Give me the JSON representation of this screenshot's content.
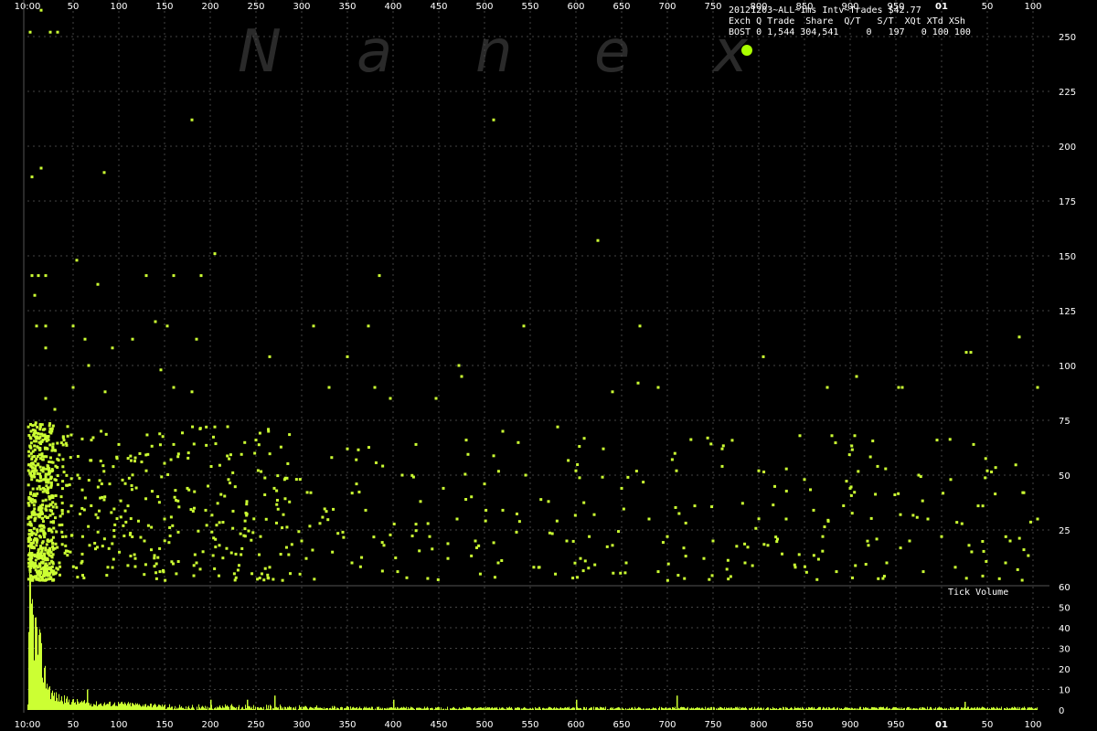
{
  "watermark": [
    "N",
    "a",
    "n",
    "e",
    "x"
  ],
  "legend": {
    "title": "20121203~ALL~1ms Intv~Trades $42.77",
    "header": "Exch Q Trade  Share  Q/T   S/T  XQt XTd XSh",
    "row": "BOST 0 1,544 304,541     0   197   0 100 100",
    "color": "#aaff00"
  },
  "volume_label": "Tick Volume",
  "chart_data": [
    {
      "type": "scatter",
      "title": "20121203~ALL~1ms Intv~Trades $42.77",
      "series": [
        {
          "name": "BOST",
          "color": "#ccff33"
        }
      ],
      "xticks": [
        "10:00",
        "50",
        "100",
        "150",
        "200",
        "250",
        "300",
        "350",
        "400",
        "450",
        "500",
        "550",
        "600",
        "650",
        "700",
        "750",
        "800",
        "850",
        "900",
        "950",
        "01",
        "50",
        "100"
      ],
      "bold_xticks": [
        "01"
      ],
      "yticks": [
        25,
        50,
        75,
        100,
        125,
        150,
        175,
        200,
        225,
        250
      ],
      "ylim": [
        0,
        265
      ],
      "grid": true,
      "points": [
        {
          "x": 3,
          "y": 252
        },
        {
          "x": 15,
          "y": 262
        },
        {
          "x": 25,
          "y": 252
        },
        {
          "x": 33,
          "y": 252
        },
        {
          "x": 15,
          "y": 190
        },
        {
          "x": 5,
          "y": 186
        },
        {
          "x": 180,
          "y": 212
        },
        {
          "x": 510,
          "y": 212
        },
        {
          "x": 84,
          "y": 188
        },
        {
          "x": 5,
          "y": 141
        },
        {
          "x": 12,
          "y": 141
        },
        {
          "x": 20,
          "y": 141
        },
        {
          "x": 130,
          "y": 141
        },
        {
          "x": 160,
          "y": 141
        },
        {
          "x": 190,
          "y": 141
        },
        {
          "x": 385,
          "y": 141
        },
        {
          "x": 54,
          "y": 148
        },
        {
          "x": 205,
          "y": 151
        },
        {
          "x": 77,
          "y": 137
        },
        {
          "x": 8,
          "y": 132
        },
        {
          "x": 624,
          "y": 157
        },
        {
          "x": 10,
          "y": 118
        },
        {
          "x": 20,
          "y": 118
        },
        {
          "x": 50,
          "y": 118
        },
        {
          "x": 140,
          "y": 120
        },
        {
          "x": 153,
          "y": 118
        },
        {
          "x": 313,
          "y": 118
        },
        {
          "x": 373,
          "y": 118
        },
        {
          "x": 543,
          "y": 118
        },
        {
          "x": 670,
          "y": 118
        },
        {
          "x": 115,
          "y": 112
        },
        {
          "x": 185,
          "y": 112
        },
        {
          "x": 20,
          "y": 108
        },
        {
          "x": 63,
          "y": 112
        },
        {
          "x": 93,
          "y": 108
        },
        {
          "x": 265,
          "y": 104
        },
        {
          "x": 350,
          "y": 104
        },
        {
          "x": 472,
          "y": 100
        },
        {
          "x": 805,
          "y": 104
        },
        {
          "x": 1027,
          "y": 106
        },
        {
          "x": 1085,
          "y": 113
        },
        {
          "x": 1032,
          "y": 106
        },
        {
          "x": 146,
          "y": 98
        },
        {
          "x": 475,
          "y": 95
        },
        {
          "x": 907,
          "y": 95
        },
        {
          "x": 67,
          "y": 100
        },
        {
          "x": 50,
          "y": 90
        },
        {
          "x": 85,
          "y": 88
        },
        {
          "x": 160,
          "y": 90
        },
        {
          "x": 180,
          "y": 88
        },
        {
          "x": 330,
          "y": 90
        },
        {
          "x": 380,
          "y": 90
        },
        {
          "x": 640,
          "y": 88
        },
        {
          "x": 668,
          "y": 92
        },
        {
          "x": 690,
          "y": 90
        },
        {
          "x": 875,
          "y": 90
        },
        {
          "x": 953,
          "y": 90
        },
        {
          "x": 957,
          "y": 90
        },
        {
          "x": 1105,
          "y": 90
        },
        {
          "x": 397,
          "y": 85
        },
        {
          "x": 447,
          "y": 85
        },
        {
          "x": 20,
          "y": 85
        },
        {
          "x": 30,
          "y": 80
        },
        {
          "x": 4,
          "y": 70
        },
        {
          "x": 18,
          "y": 68
        },
        {
          "x": 40,
          "y": 66
        },
        {
          "x": 70,
          "y": 66
        },
        {
          "x": 100,
          "y": 64
        },
        {
          "x": 160,
          "y": 64
        },
        {
          "x": 205,
          "y": 72
        },
        {
          "x": 250,
          "y": 66
        },
        {
          "x": 350,
          "y": 62
        },
        {
          "x": 425,
          "y": 64
        },
        {
          "x": 480,
          "y": 66
        },
        {
          "x": 520,
          "y": 70
        },
        {
          "x": 580,
          "y": 72
        },
        {
          "x": 630,
          "y": 62
        },
        {
          "x": 760,
          "y": 62
        },
        {
          "x": 845,
          "y": 68
        },
        {
          "x": 880,
          "y": 68
        },
        {
          "x": 905,
          "y": 68
        },
        {
          "x": 995,
          "y": 66
        },
        {
          "x": 1035,
          "y": 64
        },
        {
          "x": 10,
          "y": 52
        },
        {
          "x": 30,
          "y": 48
        },
        {
          "x": 55,
          "y": 50
        },
        {
          "x": 90,
          "y": 46
        },
        {
          "x": 130,
          "y": 52
        },
        {
          "x": 175,
          "y": 44
        },
        {
          "x": 220,
          "y": 48
        },
        {
          "x": 270,
          "y": 44
        },
        {
          "x": 310,
          "y": 42
        },
        {
          "x": 360,
          "y": 46
        },
        {
          "x": 410,
          "y": 50
        },
        {
          "x": 455,
          "y": 44
        },
        {
          "x": 500,
          "y": 46
        },
        {
          "x": 545,
          "y": 50
        },
        {
          "x": 600,
          "y": 52
        },
        {
          "x": 650,
          "y": 44
        },
        {
          "x": 710,
          "y": 52
        },
        {
          "x": 760,
          "y": 54
        },
        {
          "x": 800,
          "y": 52
        },
        {
          "x": 850,
          "y": 48
        },
        {
          "x": 900,
          "y": 44
        },
        {
          "x": 930,
          "y": 54
        },
        {
          "x": 975,
          "y": 50
        },
        {
          "x": 1010,
          "y": 48
        },
        {
          "x": 1050,
          "y": 52
        },
        {
          "x": 1090,
          "y": 42
        },
        {
          "x": 8,
          "y": 38
        },
        {
          "x": 25,
          "y": 34
        },
        {
          "x": 48,
          "y": 36
        },
        {
          "x": 75,
          "y": 32
        },
        {
          "x": 110,
          "y": 36
        },
        {
          "x": 150,
          "y": 30
        },
        {
          "x": 195,
          "y": 34
        },
        {
          "x": 240,
          "y": 38
        },
        {
          "x": 280,
          "y": 32
        },
        {
          "x": 320,
          "y": 28
        },
        {
          "x": 370,
          "y": 34
        },
        {
          "x": 430,
          "y": 38
        },
        {
          "x": 470,
          "y": 30
        },
        {
          "x": 520,
          "y": 34
        },
        {
          "x": 570,
          "y": 38
        },
        {
          "x": 620,
          "y": 32
        },
        {
          "x": 680,
          "y": 30
        },
        {
          "x": 730,
          "y": 36
        },
        {
          "x": 830,
          "y": 30
        },
        {
          "x": 860,
          "y": 34
        },
        {
          "x": 955,
          "y": 32
        },
        {
          "x": 985,
          "y": 30
        },
        {
          "x": 1040,
          "y": 36
        },
        {
          "x": 1105,
          "y": 30
        },
        {
          "x": 5,
          "y": 24
        },
        {
          "x": 22,
          "y": 20
        },
        {
          "x": 42,
          "y": 22
        },
        {
          "x": 68,
          "y": 18
        },
        {
          "x": 95,
          "y": 22
        },
        {
          "x": 128,
          "y": 20
        },
        {
          "x": 165,
          "y": 24
        },
        {
          "x": 210,
          "y": 18
        },
        {
          "x": 255,
          "y": 22
        },
        {
          "x": 300,
          "y": 20
        },
        {
          "x": 345,
          "y": 24
        },
        {
          "x": 390,
          "y": 18
        },
        {
          "x": 440,
          "y": 22
        },
        {
          "x": 490,
          "y": 20
        },
        {
          "x": 535,
          "y": 24
        },
        {
          "x": 590,
          "y": 20
        },
        {
          "x": 640,
          "y": 18
        },
        {
          "x": 700,
          "y": 22
        },
        {
          "x": 750,
          "y": 20
        },
        {
          "x": 810,
          "y": 18
        },
        {
          "x": 870,
          "y": 22
        },
        {
          "x": 920,
          "y": 18
        },
        {
          "x": 965,
          "y": 20
        },
        {
          "x": 1000,
          "y": 22
        },
        {
          "x": 1030,
          "y": 18
        },
        {
          "x": 1075,
          "y": 20
        },
        {
          "x": 1090,
          "y": 16
        },
        {
          "x": 12,
          "y": 12
        },
        {
          "x": 35,
          "y": 10
        },
        {
          "x": 60,
          "y": 14
        },
        {
          "x": 88,
          "y": 8
        },
        {
          "x": 118,
          "y": 12
        },
        {
          "x": 145,
          "y": 6
        },
        {
          "x": 185,
          "y": 10
        },
        {
          "x": 228,
          "y": 14
        },
        {
          "x": 265,
          "y": 8
        },
        {
          "x": 305,
          "y": 12
        },
        {
          "x": 355,
          "y": 10
        },
        {
          "x": 405,
          "y": 6
        },
        {
          "x": 460,
          "y": 12
        },
        {
          "x": 515,
          "y": 10
        },
        {
          "x": 560,
          "y": 8
        },
        {
          "x": 605,
          "y": 12
        },
        {
          "x": 655,
          "y": 10
        },
        {
          "x": 690,
          "y": 6
        },
        {
          "x": 740,
          "y": 12
        },
        {
          "x": 785,
          "y": 10
        },
        {
          "x": 840,
          "y": 8
        },
        {
          "x": 885,
          "y": 6
        },
        {
          "x": 940,
          "y": 10
        },
        {
          "x": 980,
          "y": 6
        },
        {
          "x": 1015,
          "y": 8
        },
        {
          "x": 1045,
          "y": 4
        },
        {
          "x": 1070,
          "y": 10
        }
      ]
    },
    {
      "type": "bar",
      "title": "Tick Volume",
      "yticks": [
        0,
        10,
        20,
        30,
        40,
        50,
        60
      ],
      "ylim": [
        0,
        60
      ],
      "series": [
        {
          "name": "BOST",
          "color": "#ccff33"
        }
      ],
      "profile": [
        {
          "x": 0,
          "y": 2
        },
        {
          "x": 2,
          "y": 57
        },
        {
          "x": 5,
          "y": 45
        },
        {
          "x": 8,
          "y": 38
        },
        {
          "x": 12,
          "y": 30
        },
        {
          "x": 15,
          "y": 24
        },
        {
          "x": 18,
          "y": 18
        },
        {
          "x": 22,
          "y": 12
        },
        {
          "x": 26,
          "y": 8
        },
        {
          "x": 32,
          "y": 6
        },
        {
          "x": 40,
          "y": 5
        },
        {
          "x": 50,
          "y": 4
        },
        {
          "x": 70,
          "y": 3
        },
        {
          "x": 100,
          "y": 3
        },
        {
          "x": 150,
          "y": 2
        },
        {
          "x": 250,
          "y": 2
        },
        {
          "x": 400,
          "y": 1
        },
        {
          "x": 600,
          "y": 1
        },
        {
          "x": 800,
          "y": 1
        },
        {
          "x": 1000,
          "y": 1
        },
        {
          "x": 1104,
          "y": 1
        }
      ],
      "spikes": [
        {
          "x": 65,
          "y": 10
        },
        {
          "x": 200,
          "y": 5
        },
        {
          "x": 240,
          "y": 5
        },
        {
          "x": 270,
          "y": 7
        },
        {
          "x": 400,
          "y": 5
        },
        {
          "x": 600,
          "y": 5
        },
        {
          "x": 710,
          "y": 7
        },
        {
          "x": 1025,
          "y": 4
        }
      ]
    }
  ]
}
